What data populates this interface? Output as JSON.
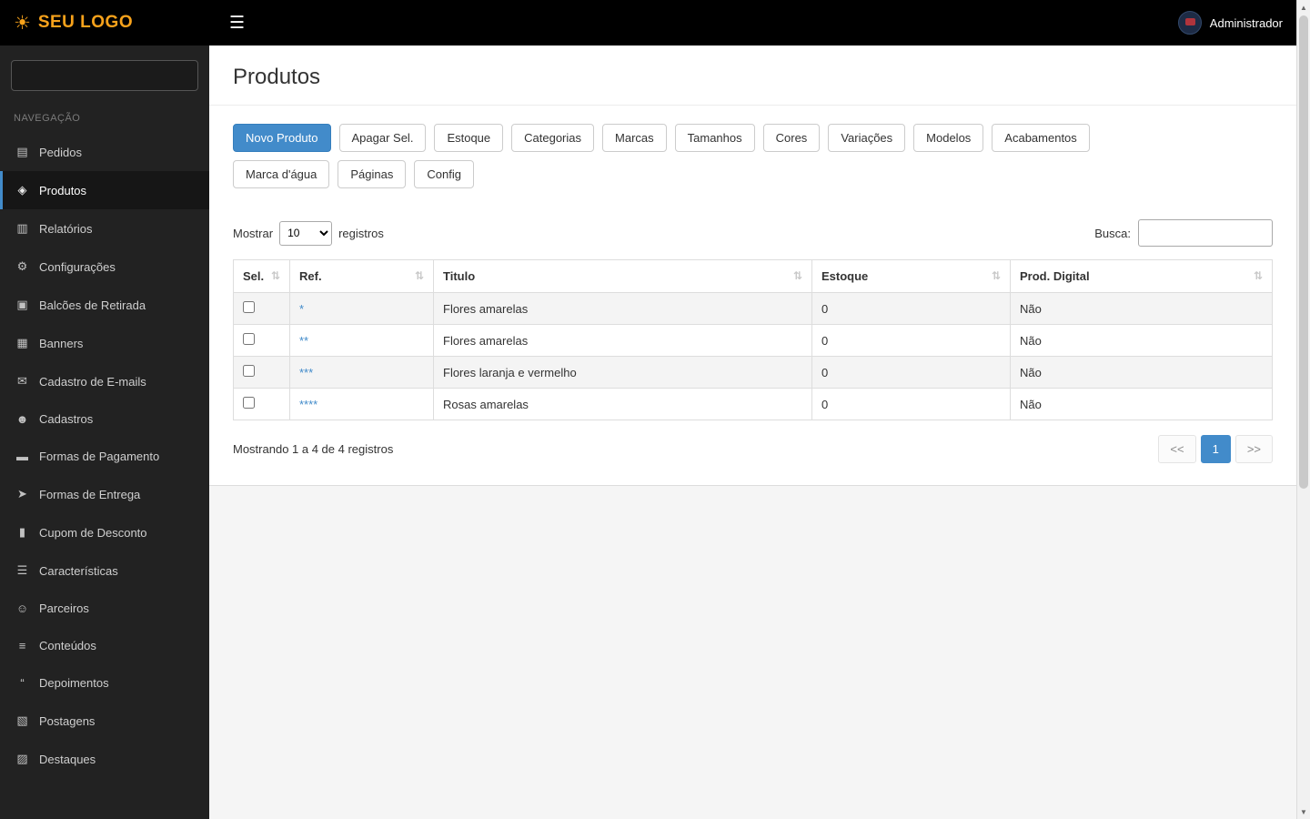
{
  "topbar": {
    "logo": "SEU LOGO",
    "user": "Administrador"
  },
  "sidebar": {
    "search_placeholder": "",
    "section_label": "NAVEGAÇÃO",
    "items": [
      {
        "id": "pedidos",
        "label": "Pedidos",
        "icon": "orders-icon",
        "active": false
      },
      {
        "id": "produtos",
        "label": "Produtos",
        "icon": "products-icon",
        "active": true
      },
      {
        "id": "relatorios",
        "label": "Relatórios",
        "icon": "reports-icon",
        "active": false
      },
      {
        "id": "configuracoes",
        "label": "Configurações",
        "icon": "settings-icon",
        "active": false
      },
      {
        "id": "balcoes-de-retirada",
        "label": "Balcões de Retirada",
        "icon": "pickup-icon",
        "active": false
      },
      {
        "id": "banners",
        "label": "Banners",
        "icon": "banners-icon",
        "active": false
      },
      {
        "id": "cadastro-de-emails",
        "label": "Cadastro de E-mails",
        "icon": "email-icon",
        "active": false
      },
      {
        "id": "cadastros",
        "label": "Cadastros",
        "icon": "users-icon",
        "active": false
      },
      {
        "id": "formas-de-pagamento",
        "label": "Formas de Pagamento",
        "icon": "payment-icon",
        "active": false
      },
      {
        "id": "formas-de-entrega",
        "label": "Formas de Entrega",
        "icon": "shipping-icon",
        "active": false
      },
      {
        "id": "cupom-de-desconto",
        "label": "Cupom de Desconto",
        "icon": "coupon-icon",
        "active": false
      },
      {
        "id": "caracteristicas",
        "label": "Características",
        "icon": "features-icon",
        "active": false
      },
      {
        "id": "parceiros",
        "label": "Parceiros",
        "icon": "partners-icon",
        "active": false
      },
      {
        "id": "conteudos",
        "label": "Conteúdos",
        "icon": "contents-icon",
        "active": false
      },
      {
        "id": "depoimentos",
        "label": "Depoimentos",
        "icon": "testimonials-icon",
        "active": false
      },
      {
        "id": "postagens",
        "label": "Postagens",
        "icon": "posts-icon",
        "active": false
      },
      {
        "id": "destaques",
        "label": "Destaques",
        "icon": "highlights-icon",
        "active": false
      }
    ]
  },
  "main": {
    "title": "Produtos",
    "toolbar_row1": [
      {
        "id": "novo-produto",
        "label": "Novo Produto",
        "active": true
      },
      {
        "id": "apagar-sel",
        "label": "Apagar Sel.",
        "active": false
      },
      {
        "id": "estoque",
        "label": "Estoque",
        "active": false
      },
      {
        "id": "categorias",
        "label": "Categorias",
        "active": false
      },
      {
        "id": "marcas",
        "label": "Marcas",
        "active": false
      },
      {
        "id": "tamanhos",
        "label": "Tamanhos",
        "active": false
      },
      {
        "id": "cores",
        "label": "Cores",
        "active": false
      },
      {
        "id": "variacoes",
        "label": "Variações",
        "active": false
      },
      {
        "id": "modelos",
        "label": "Modelos",
        "active": false
      },
      {
        "id": "acabamentos",
        "label": "Acabamentos",
        "active": false
      }
    ],
    "toolbar_row2": [
      {
        "id": "marca-dagua",
        "label": "Marca d'água",
        "active": false
      },
      {
        "id": "paginas",
        "label": "Páginas",
        "active": false
      },
      {
        "id": "config",
        "label": "Config",
        "active": false
      }
    ],
    "table": {
      "show_label": "Mostrar",
      "page_size": "10",
      "records_label": "registros",
      "search_label": "Busca:",
      "search_value": "",
      "columns": [
        {
          "id": "sel",
          "label": "Sel."
        },
        {
          "id": "ref",
          "label": "Ref."
        },
        {
          "id": "titulo",
          "label": "Titulo"
        },
        {
          "id": "estoque",
          "label": "Estoque"
        },
        {
          "id": "prod-digital",
          "label": "Prod. Digital"
        }
      ],
      "rows": [
        {
          "ref": "*",
          "titulo": "Flores amarelas",
          "estoque": "0",
          "prod_digital": "Não"
        },
        {
          "ref": "**",
          "titulo": "Flores amarelas",
          "estoque": "0",
          "prod_digital": "Não"
        },
        {
          "ref": "***",
          "titulo": "Flores laranja e vermelho",
          "estoque": "0",
          "prod_digital": "Não"
        },
        {
          "ref": "****",
          "titulo": "Rosas amarelas",
          "estoque": "0",
          "prod_digital": "Não"
        }
      ],
      "info": "Mostrando 1 a 4 de 4 registros",
      "pagination": {
        "prev": "<<",
        "current": "1",
        "next": ">>"
      }
    }
  },
  "colors": {
    "accent": "#428bca",
    "logo_orange": "#f7a21b",
    "topbar_bg": "#000000",
    "sidebar_bg": "#222222"
  }
}
